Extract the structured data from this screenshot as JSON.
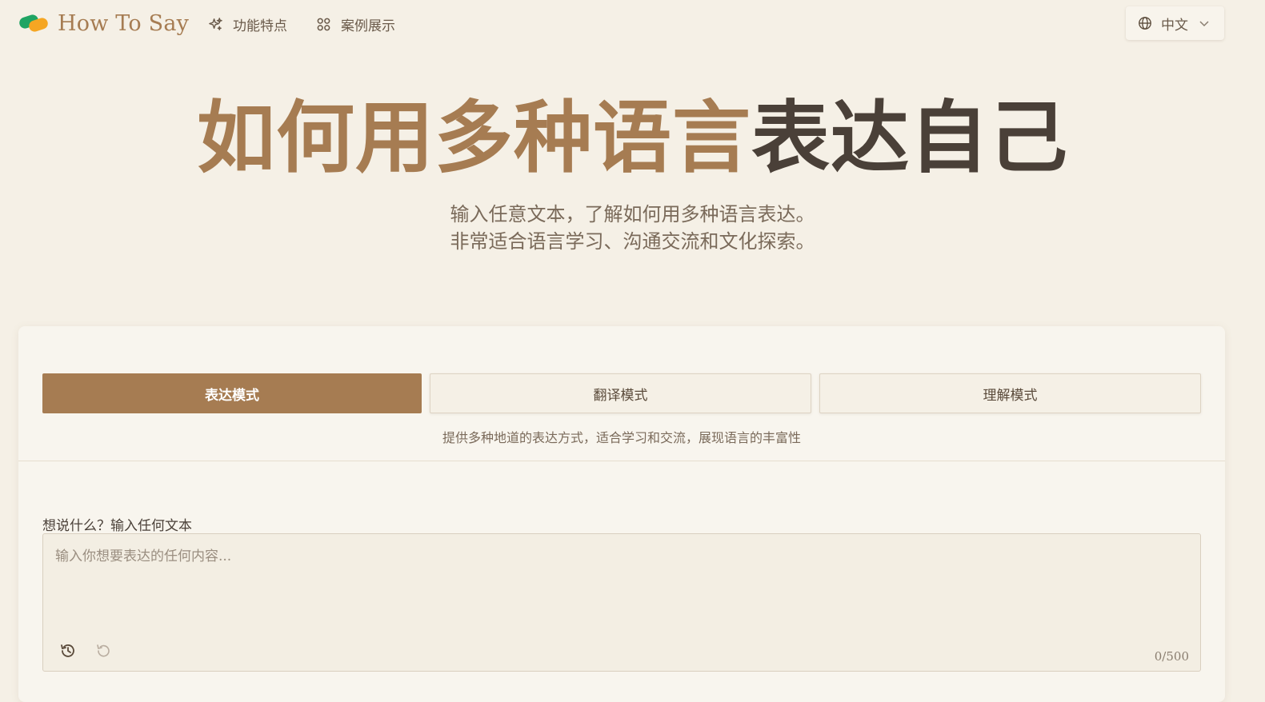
{
  "brand": {
    "name": "How To Say",
    "logo_icon": "leaf-logo-icon"
  },
  "nav": {
    "features": {
      "label": "功能特点",
      "icon": "sparkles-icon"
    },
    "examples": {
      "label": "案例展示",
      "icon": "grid-icon"
    }
  },
  "language_selector": {
    "label": "中文",
    "icon": "globe-icon"
  },
  "hero": {
    "title_highlight": "如何用多种语言",
    "title_rest": "表达自己",
    "subtitle_line1": "输入任意文本，了解如何用多种语言表达。",
    "subtitle_line2": "非常适合语言学习、沟通交流和文化探索。"
  },
  "modes": {
    "items": [
      {
        "label": "表达模式",
        "active": true
      },
      {
        "label": "翻译模式",
        "active": false
      },
      {
        "label": "理解模式",
        "active": false
      }
    ],
    "description": "提供多种地道的表达方式，适合学习和交流，展现语言的丰富性"
  },
  "input": {
    "label": "想说什么？输入任何文本",
    "placeholder": "输入你想要表达的任何内容...",
    "value": "",
    "char_count": "0/500",
    "history_icon": "history-icon",
    "undo_icon": "undo-icon"
  },
  "colors": {
    "accent": "#a67c52",
    "background": "#f5f0e6",
    "dark_text": "#4a4038"
  }
}
